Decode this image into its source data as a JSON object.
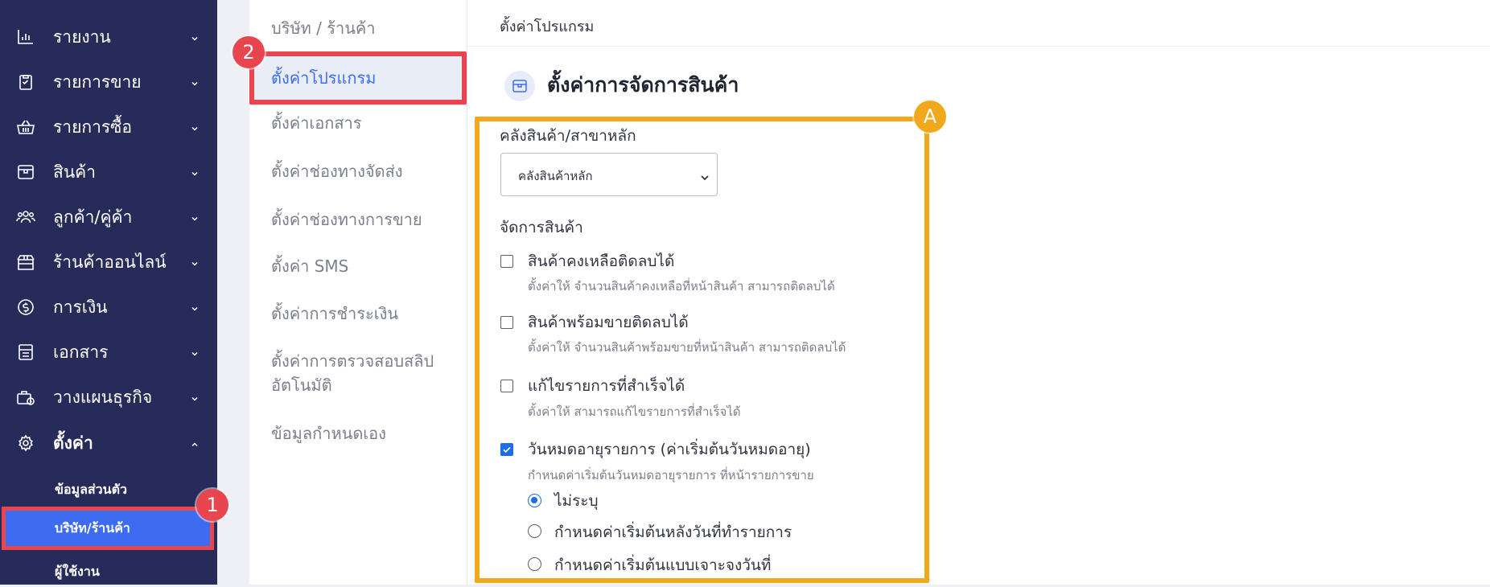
{
  "sidebar": {
    "items": [
      {
        "label": "รายงาน",
        "icon": "bar-chart-icon"
      },
      {
        "label": "รายการขาย",
        "icon": "clipboard-icon"
      },
      {
        "label": "รายการซื้อ",
        "icon": "basket-icon"
      },
      {
        "label": "สินค้า",
        "icon": "box-icon"
      },
      {
        "label": "ลูกค้า/คู่ค้า",
        "icon": "users-icon"
      },
      {
        "label": "ร้านค้าออนไลน์",
        "icon": "store-icon"
      },
      {
        "label": "การเงิน",
        "icon": "dollar-coin-icon"
      },
      {
        "label": "เอกสาร",
        "icon": "document-icon"
      },
      {
        "label": "วางแผนธุรกิจ",
        "icon": "briefcase-icon"
      },
      {
        "label": "ตั้งค่า",
        "icon": "gear-icon"
      }
    ],
    "settings_sub": [
      {
        "label": "ข้อมูลส่วนตัว"
      },
      {
        "label": "บริษัท/ร้านค้า"
      },
      {
        "label": "ผู้ใช้งาน"
      }
    ]
  },
  "settings_menu": {
    "items": [
      {
        "label": "บริษัท / ร้านค้า"
      },
      {
        "label": "ตั้งค่าโปรแกรม"
      },
      {
        "label": "ตั้งค่าเอกสาร"
      },
      {
        "label": "ตั้งค่าช่องทางจัดส่ง"
      },
      {
        "label": "ตั้งค่าช่องทางการขาย"
      },
      {
        "label": "ตั้งค่า SMS"
      },
      {
        "label": "ตั้งค่าการชำระเงิน"
      },
      {
        "label": "ตั้งค่าการตรวจสอบสลิป",
        "label2": "อัตโนมัติ"
      },
      {
        "label": "ข้อมูลกำหนดเอง"
      }
    ]
  },
  "main": {
    "breadcrumb": "ตั้งค่าโปรแกรม",
    "title": "ตั้งค่าการจัดการสินค้า",
    "warehouse": {
      "label": "คลังสินค้า/สาขาหลัก",
      "selected": "คลังสินค้าหลัก"
    },
    "manage_label": "จัดการสินค้า",
    "options": [
      {
        "title": "สินค้าคงเหลือติดลบได้",
        "desc": "ตั้งค่าให้ จำนวนสินค้าคงเหลือที่หน้าสินค้า สามารถติดลบได้",
        "checked": false
      },
      {
        "title": "สินค้าพร้อมขายติดลบได้",
        "desc": "ตั้งค่าให้ จำนวนสินค้าพร้อมขายที่หน้าสินค้า สามารถติดลบได้",
        "checked": false
      },
      {
        "title": "แก้ไขรายการที่สำเร็จได้",
        "desc": "ตั้งค่าให้ สามารถแก้ไขรายการที่สำเร็จได้",
        "checked": false
      },
      {
        "title": "วันหมดอายุรายการ (ค่าเริ่มต้นวันหมดอายุ)",
        "desc": "กำหนดค่าเริ่มต้นวันหมดอายุรายการ ที่หน้ารายการขาย",
        "checked": true
      }
    ],
    "expiry_radios": [
      {
        "label": "ไม่ระบุ",
        "selected": true
      },
      {
        "label": "กำหนดค่าเริ่มต้นหลังวันที่ทำรายการ",
        "selected": false
      },
      {
        "label": "กำหนดค่าเริ่มต้นแบบเจาะจงวันที่",
        "selected": false
      }
    ]
  },
  "annotations": {
    "badge_1": "1",
    "badge_2": "2",
    "badge_A": "A"
  },
  "colors": {
    "sidebar_bg": "#262b5a",
    "accent": "#3d6cf0",
    "highlight_red": "#e9454f",
    "highlight_orange": "#f2a81d"
  }
}
